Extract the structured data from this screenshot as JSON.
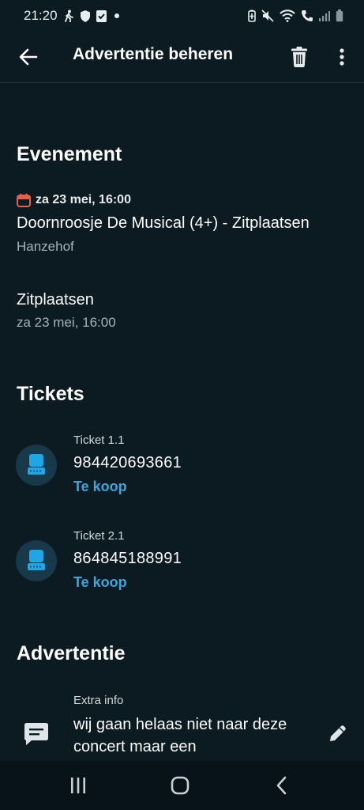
{
  "status_bar": {
    "time": "21:20",
    "left_icons": [
      "walk-icon",
      "shield-icon",
      "check-shield-icon",
      "dot-icon"
    ],
    "right_icons": [
      "battery-saver-icon",
      "mute-icon",
      "wifi-icon",
      "call-icon",
      "signal-icon",
      "battery-icon"
    ]
  },
  "app_bar": {
    "title": "Advertentie beheren",
    "back_icon": "arrow-left-icon",
    "delete_icon": "trash-icon",
    "more_icon": "more-vertical-icon"
  },
  "event_section": {
    "title": "Evenement",
    "date_icon": "calendar-icon",
    "date": "za 23 mei, 16:00",
    "name": "Doornroosje De Musical (4+) - Zitplaatsen",
    "venue": "Hanzehof",
    "category": {
      "name": "Zitplaatsen",
      "date": "za 23 mei, 16:00"
    }
  },
  "tickets_section": {
    "title": "Tickets",
    "items": [
      {
        "label": "Ticket 1.1",
        "number": "984420693661",
        "status": "Te koop",
        "icon": "ticket-seat-icon"
      },
      {
        "label": "Ticket 2.1",
        "number": "864845188991",
        "status": "Te koop",
        "icon": "ticket-seat-icon"
      }
    ]
  },
  "advert_section": {
    "title": "Advertentie",
    "extra_info_label": "Extra info",
    "extra_info_text": "wij gaan helaas niet naar deze concert maar een",
    "icon": "comment-icon",
    "edit_icon": "pencil-icon"
  },
  "nav_bar": {
    "recent_icon": "recent-apps-icon",
    "home_icon": "home-icon",
    "back_icon": "back-icon"
  },
  "colors": {
    "background": "#0c1a21",
    "accent_link": "#3aa6e0",
    "ticket_icon_bg": "#173949",
    "ticket_icon_fg": "#1fa6e6",
    "calendar_red": "#e8604c"
  }
}
